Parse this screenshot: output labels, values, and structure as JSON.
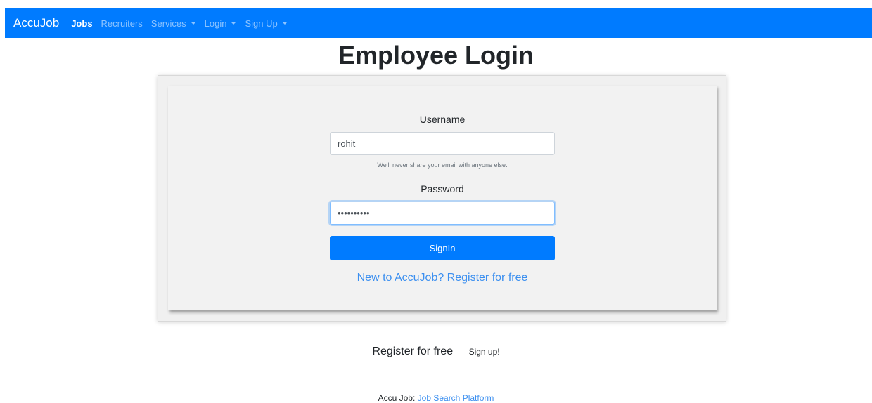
{
  "navbar": {
    "brand": "AccuJob",
    "links": [
      {
        "label": "Jobs",
        "active": true,
        "dropdown": false
      },
      {
        "label": "Recruiters",
        "active": false,
        "dropdown": false
      },
      {
        "label": "Services",
        "active": false,
        "dropdown": true
      },
      {
        "label": "Login",
        "active": false,
        "dropdown": true
      },
      {
        "label": "Sign Up",
        "active": false,
        "dropdown": true
      }
    ]
  },
  "page": {
    "title": "Employee Login"
  },
  "form": {
    "username_label": "Username",
    "username_value": "rohit",
    "help_text": "We'll never share your email with anyone else.",
    "password_label": "Password",
    "password_value": "••••••••••",
    "signin_label": "SignIn",
    "register_link": "New to AccuJob? Register for free"
  },
  "bottom": {
    "register_text": "Register for free",
    "signup_link": "Sign up!"
  },
  "footer": {
    "prefix": "Accu Job:",
    "link": "Job Search Platform"
  },
  "colors": {
    "primary": "#007bff",
    "link": "#3b8ff0"
  }
}
